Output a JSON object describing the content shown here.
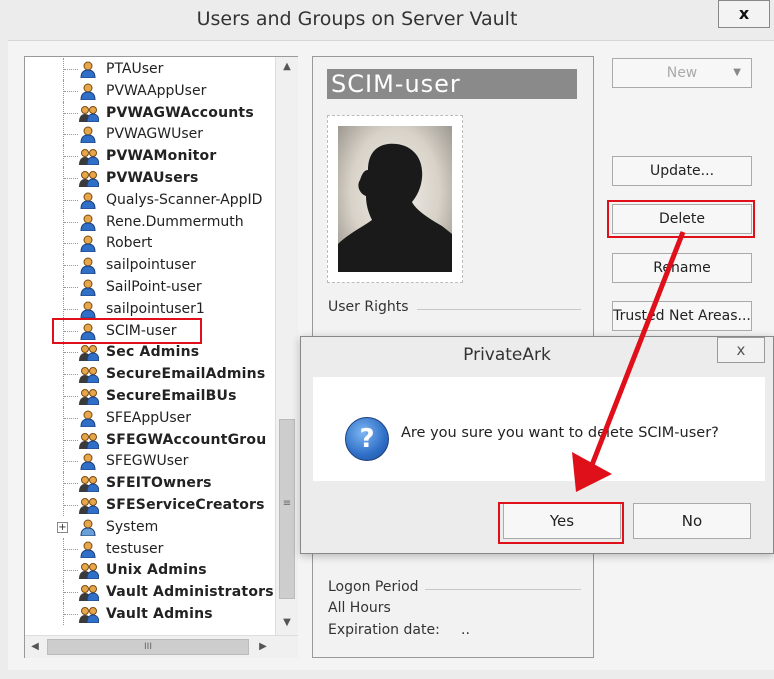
{
  "window": {
    "title": "Users and Groups on Server Vault",
    "close_label": "x"
  },
  "tree": {
    "items": [
      {
        "label": "PTAUser",
        "bold": false,
        "type": "user"
      },
      {
        "label": "PVWAAppUser",
        "bold": false,
        "type": "user"
      },
      {
        "label": "PVWAGWAccounts",
        "bold": true,
        "type": "group"
      },
      {
        "label": "PVWAGWUser",
        "bold": false,
        "type": "user"
      },
      {
        "label": "PVWAMonitor",
        "bold": true,
        "type": "group"
      },
      {
        "label": "PVWAUsers",
        "bold": true,
        "type": "group"
      },
      {
        "label": "Qualys-Scanner-AppID",
        "bold": false,
        "type": "user"
      },
      {
        "label": "Rene.Dummermuth",
        "bold": false,
        "type": "user"
      },
      {
        "label": "Robert",
        "bold": false,
        "type": "user"
      },
      {
        "label": "sailpointuser",
        "bold": false,
        "type": "user"
      },
      {
        "label": "SailPoint-user",
        "bold": false,
        "type": "user"
      },
      {
        "label": "sailpointuser1",
        "bold": false,
        "type": "user"
      },
      {
        "label": "SCIM-user",
        "bold": false,
        "type": "user",
        "selected": true
      },
      {
        "label": "Sec Admins",
        "bold": true,
        "type": "group"
      },
      {
        "label": "SecureEmailAdmins",
        "bold": true,
        "type": "group"
      },
      {
        "label": "SecureEmailBUs",
        "bold": true,
        "type": "group"
      },
      {
        "label": "SFEAppUser",
        "bold": false,
        "type": "user"
      },
      {
        "label": "SFEGWAccountGrou",
        "bold": true,
        "type": "group"
      },
      {
        "label": "SFEGWUser",
        "bold": false,
        "type": "user"
      },
      {
        "label": "SFEITOwners",
        "bold": true,
        "type": "group"
      },
      {
        "label": "SFEServiceCreators",
        "bold": true,
        "type": "group"
      },
      {
        "label": "System",
        "bold": false,
        "type": "location",
        "expandable": true
      },
      {
        "label": "testuser",
        "bold": false,
        "type": "user"
      },
      {
        "label": "Unix Admins",
        "bold": true,
        "type": "group"
      },
      {
        "label": "Vault Administrators",
        "bold": true,
        "type": "group"
      },
      {
        "label": "Vault Admins",
        "bold": true,
        "type": "group"
      }
    ],
    "scroll_glyphs": {
      "up": "▲",
      "down": "▼",
      "left": "◀",
      "right": "▶",
      "grip": "≡",
      "hgrip": "III"
    }
  },
  "details": {
    "user_name": "SCIM-user",
    "user_rights_label": "User Rights",
    "logon_period_label": "Logon Period",
    "logon_period_value": "All Hours",
    "expiration_label": "Expiration date:",
    "expiration_value": ".."
  },
  "buttons": {
    "new": "New",
    "update": "Update...",
    "delete": "Delete",
    "rename": "Rename",
    "trusted": "Trusted Net Areas..."
  },
  "dialog": {
    "title": "PrivateArk",
    "close_label": "x",
    "message": "Are you sure you want to delete SCIM-user?",
    "icon": "question-icon",
    "icon_glyph": "?",
    "yes": "Yes",
    "no": "No"
  },
  "colors": {
    "highlight": "#e0101a",
    "accent_blue": "#2f6fc7"
  }
}
